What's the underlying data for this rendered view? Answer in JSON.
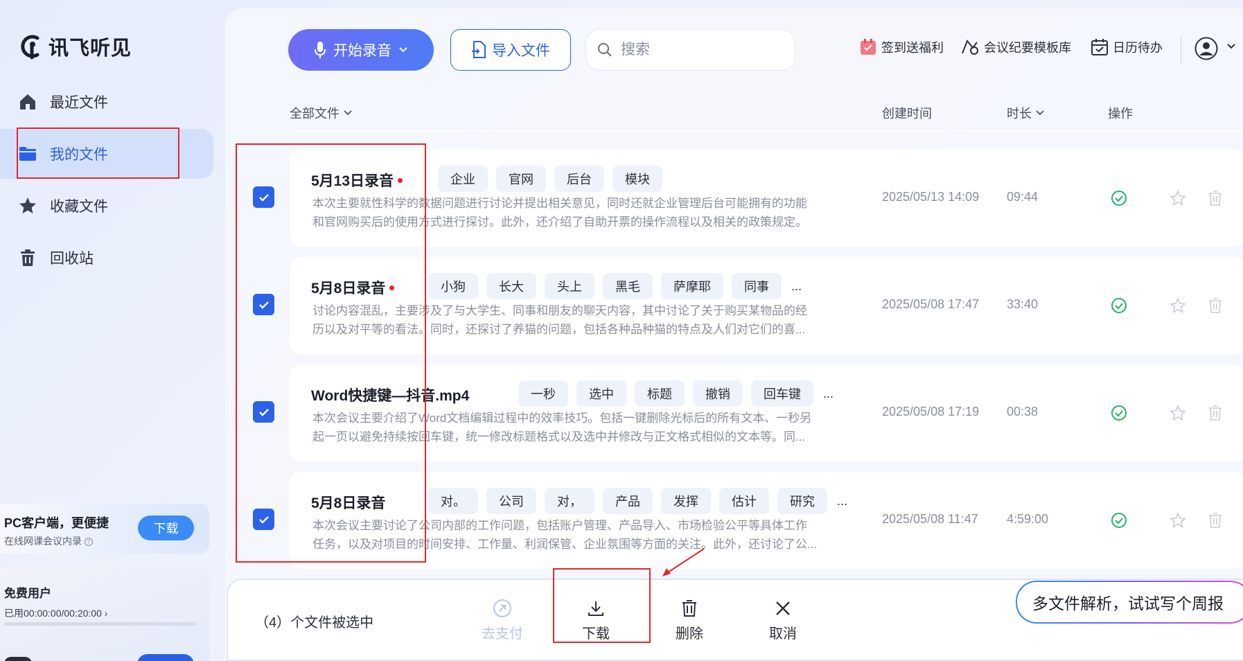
{
  "app": {
    "name": "讯飞听见"
  },
  "sidebar": {
    "items": [
      {
        "label": "最近文件",
        "icon": "home-icon"
      },
      {
        "label": "我的文件",
        "icon": "folder-icon",
        "active": true
      },
      {
        "label": "收藏文件",
        "icon": "star-icon"
      },
      {
        "label": "回收站",
        "icon": "trash-icon"
      }
    ],
    "promo": {
      "title": "PC客户端，更便捷",
      "subtitle": "在线网课会议内录",
      "button": "下载"
    },
    "account": {
      "title": "免费用户",
      "usage": "已用00:00:00/00:20:00"
    }
  },
  "toolbar": {
    "record_label": "开始录音",
    "import_label": "导入文件",
    "search_placeholder": "搜索",
    "links": [
      {
        "label": "签到送福利",
        "icon": "gift-calendar-icon"
      },
      {
        "label": "会议纪要模板库",
        "icon": "template-icon"
      },
      {
        "label": "日历待办",
        "icon": "calendar-check-icon"
      }
    ]
  },
  "table": {
    "headers": {
      "files": "全部文件",
      "created": "创建时间",
      "duration": "时长",
      "actions": "操作"
    },
    "rows": [
      {
        "title": "5月13日录音",
        "unread": true,
        "checked": true,
        "tags": [
          "企业",
          "官网",
          "后台",
          "模块"
        ],
        "more": false,
        "desc1": "本次主要就性科学的数据问题进行讨论并提出相关意见，同时还就企业管理后台可能拥有的功能",
        "desc2": "和官网购买后的使用方式进行探讨。此外，还介绍了自助开票的操作流程以及相关的政策规定。",
        "created": "2025/05/13 14:09",
        "duration": "09:44"
      },
      {
        "title": "5月8日录音",
        "unread": true,
        "checked": true,
        "tags": [
          "小狗",
          "长大",
          "头上",
          "黑毛",
          "萨摩耶",
          "同事"
        ],
        "more": true,
        "desc1": "讨论内容混乱，主要涉及了与大学生、同事和朋友的聊天内容，其中讨论了关于购买某物品的经",
        "desc2": "历以及对平等的看法。同时，还探讨了养猫的问题，包括各种品种猫的特点及人们对它们的喜...",
        "created": "2025/05/08 17:47",
        "duration": "33:40"
      },
      {
        "title": "Word快捷键—抖音.mp4",
        "unread": false,
        "checked": true,
        "tags": [
          "一秒",
          "选中",
          "标题",
          "撤销",
          "回车键"
        ],
        "more": true,
        "desc1": "本次会议主要介绍了Word文档编辑过程中的效率技巧。包括一键删除光标后的所有文本、一秒另",
        "desc2": "起一页以避免持续按回车键，统一修改标题格式以及选中并修改与正文格式相似的文本等。同...",
        "created": "2025/05/08 17:19",
        "duration": "00:38"
      },
      {
        "title": "5月8日录音",
        "unread": false,
        "checked": true,
        "tags": [
          "对。",
          "公司",
          "对，",
          "产品",
          "发挥",
          "估计",
          "研究"
        ],
        "more": true,
        "desc1": "本次会议主要讨论了公司内部的工作问题，包括账户管理、产品导入、市场检验公平等具体工作",
        "desc2": "任务，以及对项目的时间安排、工作量、利润保管、企业氛围等方面的关注。此外，还讨论了公...",
        "created": "2025/05/08 11:47",
        "duration": "4:59:00"
      }
    ],
    "more_label": "..."
  },
  "action_bar": {
    "selected_text": "（4）个文件被选中",
    "actions": [
      {
        "label": "去支付",
        "icon": "pay-icon",
        "disabled": true
      },
      {
        "label": "下载",
        "icon": "download-icon",
        "disabled": false
      },
      {
        "label": "删除",
        "icon": "delete-icon",
        "disabled": false
      },
      {
        "label": "取消",
        "icon": "close-icon",
        "disabled": false
      }
    ],
    "tip": "多文件解析，试试写个周报"
  },
  "colors": {
    "accent": "#2b62e6",
    "annotation": "#e5262b",
    "status_ok": "#1fb36a"
  }
}
